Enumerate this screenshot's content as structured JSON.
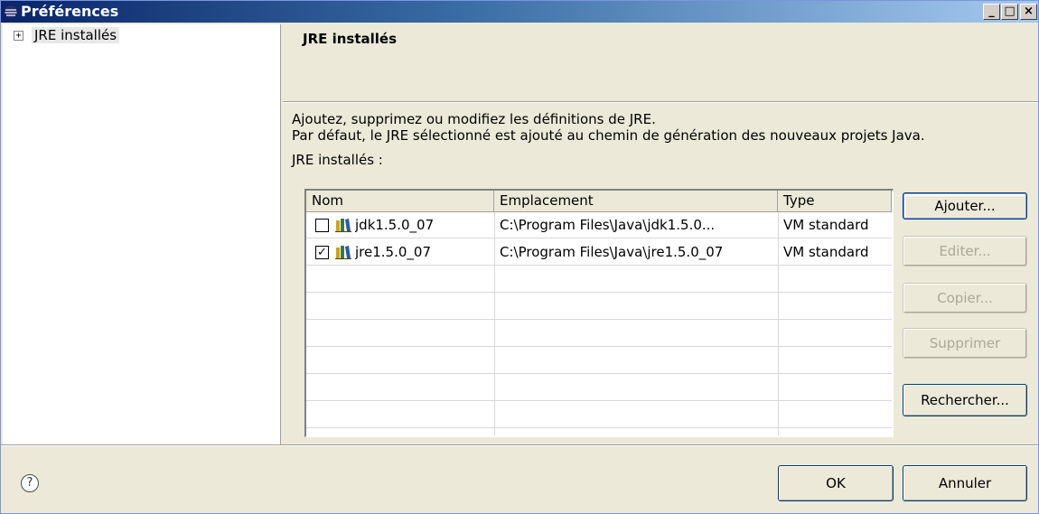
{
  "window": {
    "title": "Préférences",
    "controls": [
      "_",
      "□",
      "×"
    ]
  },
  "tree": {
    "expander": "+",
    "items": [
      {
        "label": "JRE installés"
      }
    ]
  },
  "page": {
    "title": "JRE installés",
    "description_line1": "Ajoutez, supprimez ou modifiez les définitions de JRE.",
    "description_line2": "Par défaut, le JRE sélectionné est ajouté au chemin de génération des nouveaux projets Java.",
    "table_label": "JRE installés :"
  },
  "table": {
    "columns": [
      "Nom",
      "Emplacement",
      "Type"
    ],
    "rows": [
      {
        "checked": false,
        "check_glyph": "",
        "name": "jdk1.5.0_07",
        "location": "C:\\Program Files\\Java\\jdk1.5.0...",
        "type": "VM standard"
      },
      {
        "checked": true,
        "check_glyph": "✓",
        "name": "jre1.5.0_07",
        "location": "C:\\Program Files\\Java\\jre1.5.0_07",
        "type": "VM standard"
      }
    ]
  },
  "side_buttons": {
    "add": "Ajouter...",
    "edit": "Editer...",
    "copy": "Copier...",
    "remove": "Supprimer",
    "search": "Rechercher..."
  },
  "footer": {
    "help_glyph": "?",
    "ok": "OK",
    "cancel": "Annuler"
  },
  "icons": [
    "window-app-icon",
    "minimize-icon",
    "maximize-icon",
    "close-icon",
    "tree-expand-icon",
    "jre-library-icon",
    "help-icon"
  ],
  "colors": {
    "title_gradient_start": "#0a246a",
    "title_gradient_end": "#a6caf0",
    "dialog_bg": "#ece9d8"
  }
}
